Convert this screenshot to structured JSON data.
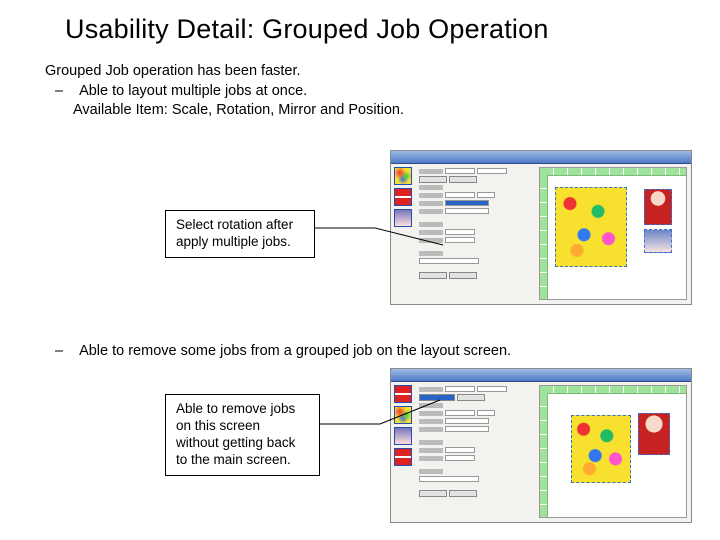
{
  "title": "Usability Detail: Grouped Job Operation",
  "intro": {
    "line1": "Grouped Job operation has been faster.",
    "bullet1": "Able to layout multiple jobs at once.",
    "line2": "Available Item: Scale, Rotation, Mirror and Position."
  },
  "callouts": {
    "c1_line1": "Select rotation after",
    "c1_line2": "apply multiple jobs.",
    "c2_line1": "Able to remove jobs",
    "c2_line2": "on this screen",
    "c2_line3": "without getting back",
    "c2_line4": "to the main screen."
  },
  "mid_bullet": "Able to remove some jobs from a grouped job on the layout screen.",
  "screenshots": {
    "s1": {
      "thumbs": [
        "balloons",
        "santa",
        "photo"
      ]
    },
    "s2": {
      "thumbs": [
        "santa",
        "balloons",
        "photo",
        "santa"
      ]
    }
  }
}
